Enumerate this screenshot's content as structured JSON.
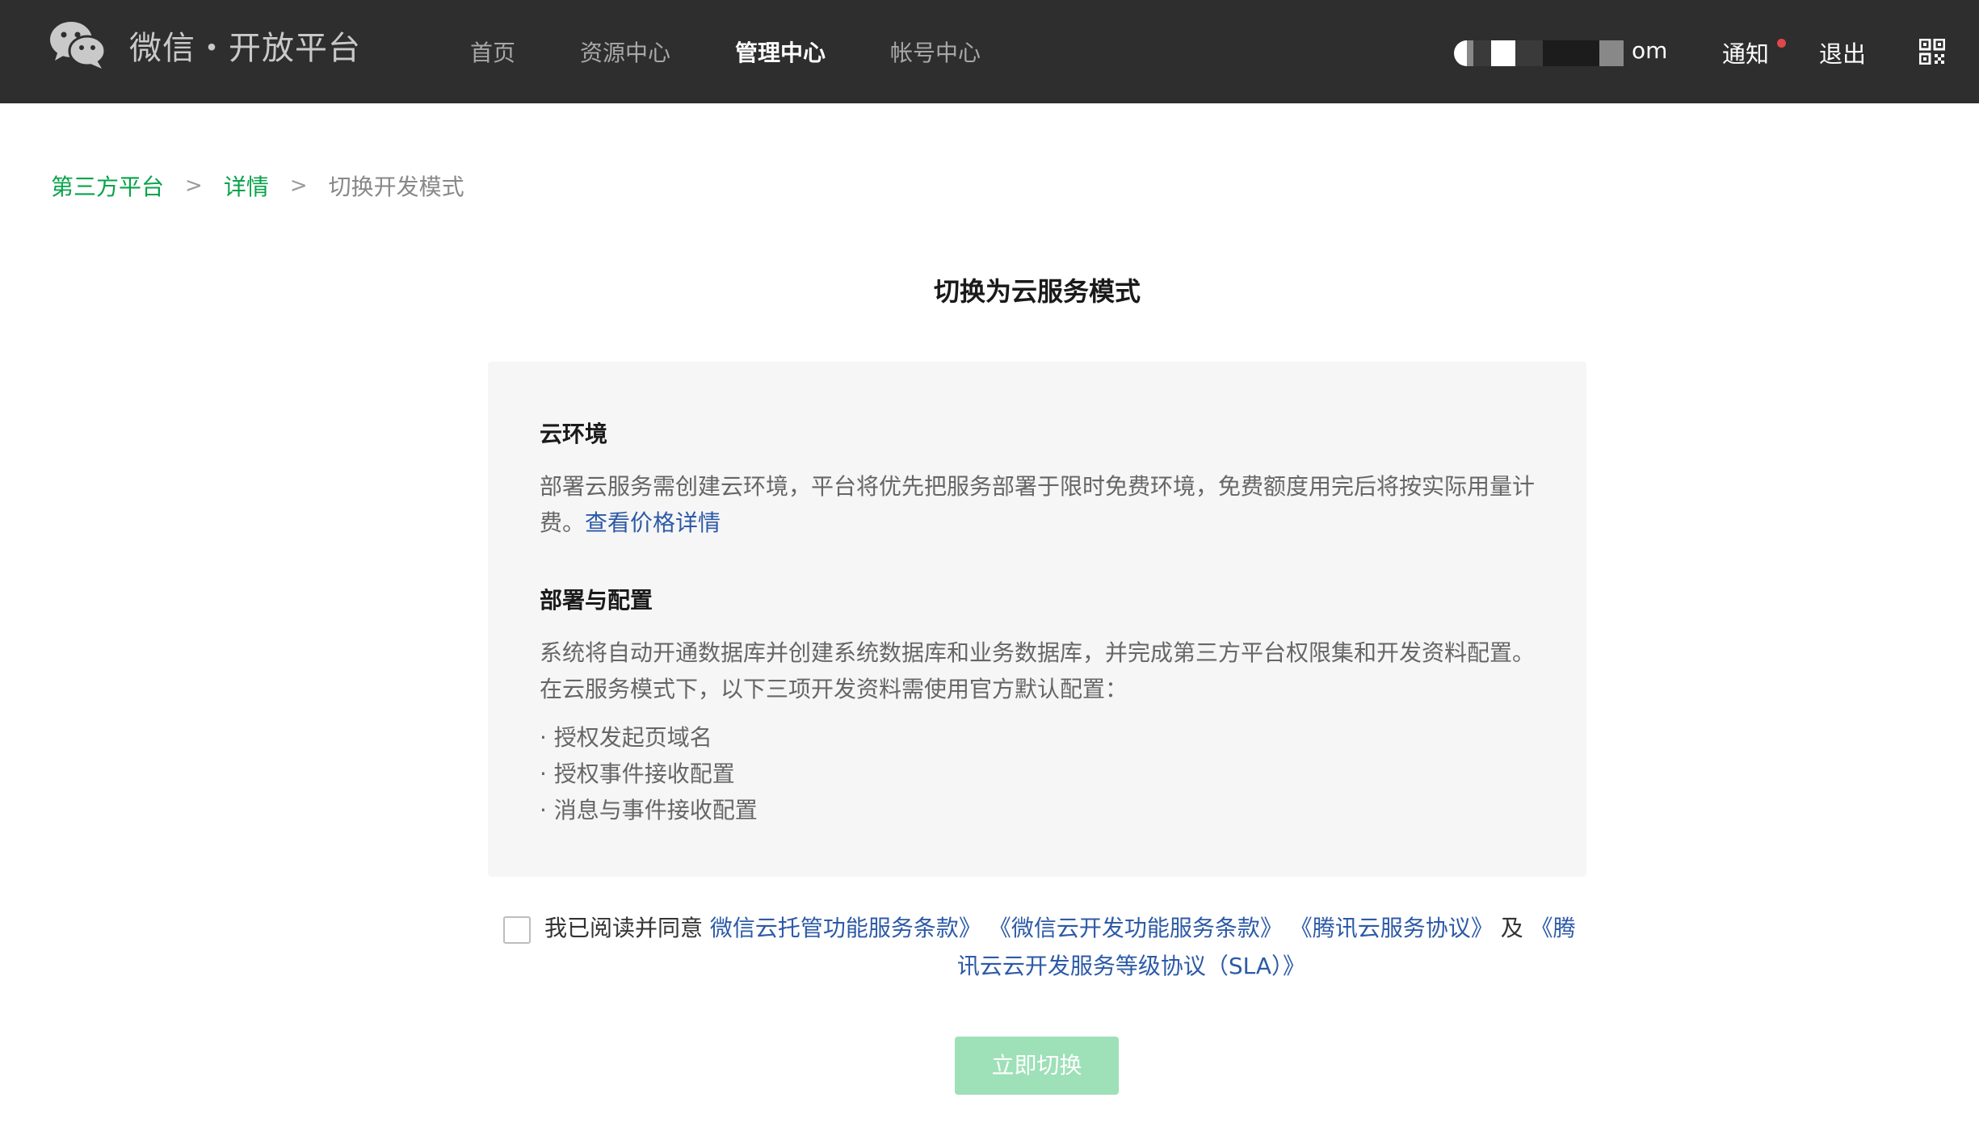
{
  "header": {
    "logo_text": "微信・开放平台",
    "nav": [
      {
        "label": "首页"
      },
      {
        "label": "资源中心"
      },
      {
        "label": "管理中心"
      },
      {
        "label": "帐号中心"
      }
    ],
    "active_nav": "管理中心",
    "user_suffix": "om",
    "notify_label": "通知",
    "logout_label": "退出",
    "colors": {
      "bar": "#2e2e2e",
      "notify_dot": "#e0474a"
    }
  },
  "breadcrumb": {
    "items": [
      "第三方平台",
      "详情"
    ],
    "current": "切换开发模式",
    "separator": ">"
  },
  "page": {
    "title": "切换为云服务模式"
  },
  "info": {
    "section1_title": "云环境",
    "section1_text": "部署云服务需创建云环境，平台将优先把服务部署于限时免费环境，免费额度用完后将按实际用量计费。",
    "section1_link": "查看价格详情",
    "section2_title": "部署与配置",
    "section2_text_line1": "系统将自动开通数据库并创建系统数据库和业务数据库，并完成第三方平台权限集和开发资料配置。",
    "section2_text_line2": "在云服务模式下，以下三项开发资料需使用官方默认配置：",
    "bullets": [
      "· 授权发起页域名",
      "· 授权事件接收配置",
      "· 消息与事件接收配置"
    ]
  },
  "agreement": {
    "prefix": "我已阅读并同意",
    "term1": "微信云托管功能服务条款》",
    "term2": "《微信云开发功能服务条款》",
    "term3": "《腾讯云服务协议》",
    "joiner": "及",
    "term4_part1": "《腾",
    "term4_part2": "讯云云开发服务等级协议（SLA）》",
    "checked": false
  },
  "actions": {
    "switch_label": "立即切换",
    "switch_color": "#9ee0b8",
    "accent": "#07a34a",
    "link_color": "#2d5aa7"
  }
}
